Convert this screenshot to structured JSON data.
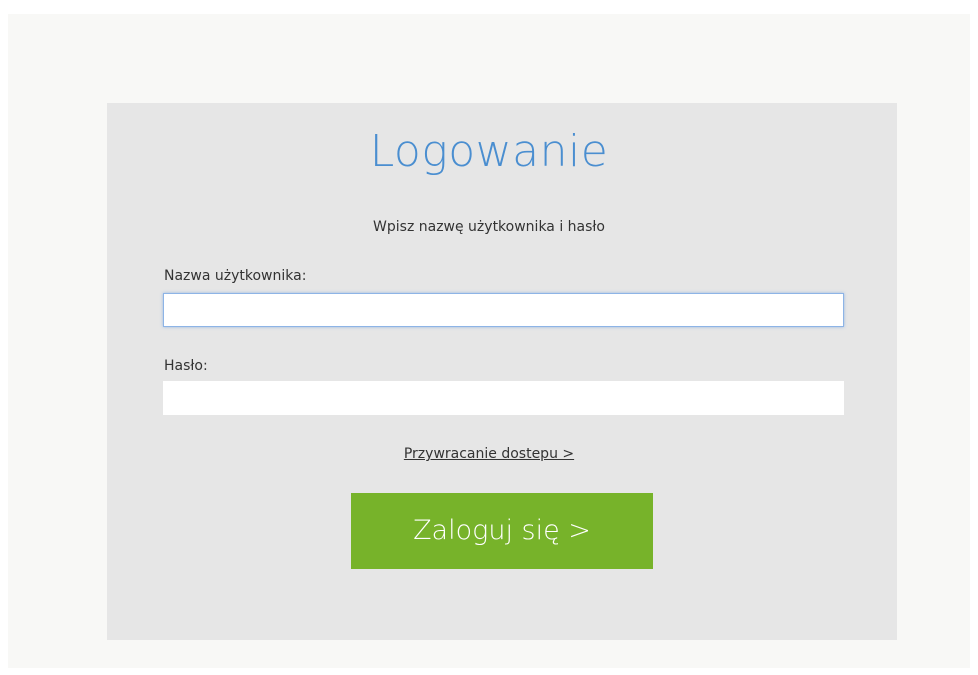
{
  "login": {
    "title": "Logowanie",
    "subtitle": "Wpisz nazwę użytkownika i hasło",
    "username_label": "Nazwa użytkownika:",
    "username_value": "",
    "password_label": "Hasło:",
    "password_value": "",
    "recover_link": "Przywracanie dostepu >",
    "submit_label": "Zaloguj się >"
  },
  "colors": {
    "panel_background": "#e6e6e6",
    "title_blue": "#4a8ed0",
    "button_green": "#77b32a",
    "focus_border": "#8db4e6"
  }
}
